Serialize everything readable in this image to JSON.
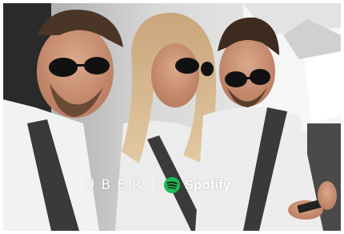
{
  "promo": {
    "left_brand": "UBER",
    "right_brand": "Spotify"
  },
  "colors": {
    "spotify_green": "#1db954",
    "brand_text": "#ffffff"
  },
  "icons": {
    "spotify_logo": "spotify-icon"
  }
}
